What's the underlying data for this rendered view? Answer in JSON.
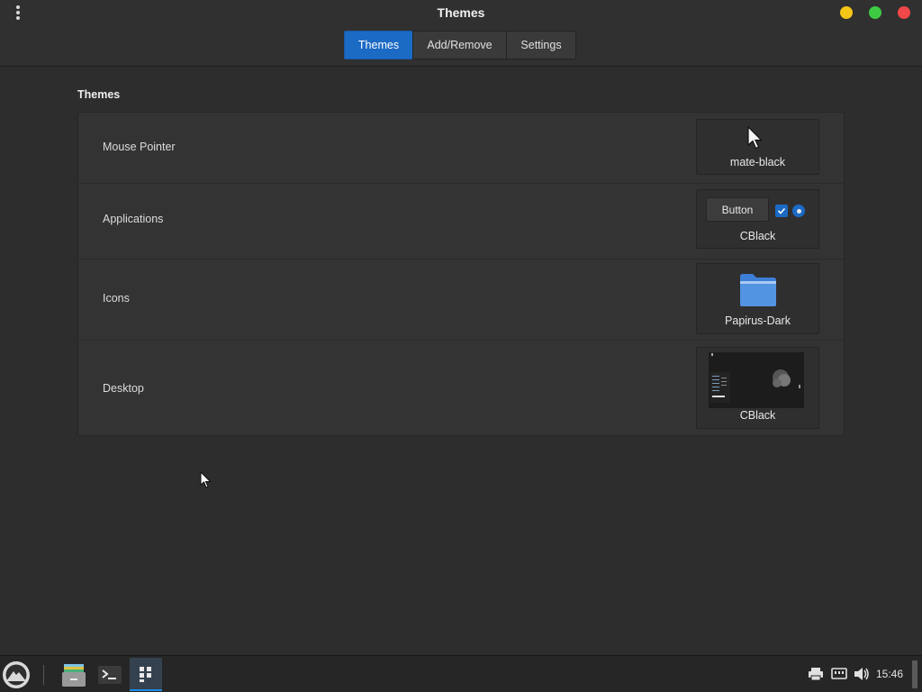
{
  "window": {
    "title": "Themes",
    "controls": [
      "minimize",
      "maximize",
      "close"
    ]
  },
  "tabs": [
    {
      "label": "Themes",
      "active": true
    },
    {
      "label": "Add/Remove",
      "active": false
    },
    {
      "label": "Settings",
      "active": false
    }
  ],
  "section": {
    "title": "Themes",
    "rows": [
      {
        "label": "Mouse Pointer",
        "value": "mate-black",
        "preview": "arrow-cursor-icon"
      },
      {
        "label": "Applications",
        "value": "CBlack",
        "preview_button_label": "Button"
      },
      {
        "label": "Icons",
        "value": "Papirus-Dark",
        "preview": "folder-icon"
      },
      {
        "label": "Desktop",
        "value": "CBlack",
        "preview": "desktop-thumbnail"
      }
    ]
  },
  "taskbar": {
    "apps": [
      "file-manager-icon",
      "terminal-icon",
      "settings-app-icon"
    ],
    "tray": [
      "printer-icon",
      "network-icon",
      "volume-icon"
    ],
    "clock": "15:46"
  },
  "colors": {
    "accent": "#1b6ac4",
    "background": "#2d2d2d",
    "panel": "#333333"
  }
}
